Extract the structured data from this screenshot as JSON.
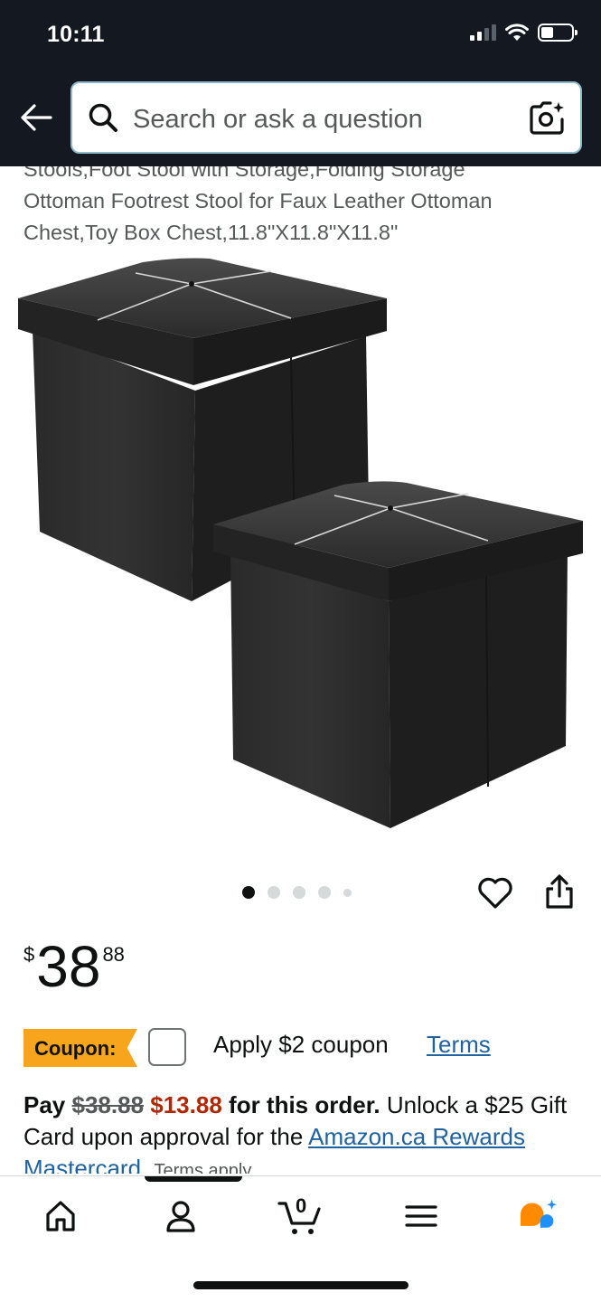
{
  "status_bar": {
    "time": "10:11"
  },
  "header": {
    "search_placeholder": "Search or ask a question"
  },
  "product": {
    "title_lines": [
      "Stools,Foot Stool with Storage,Folding Storage",
      "Ottoman Footrest Stool for Faux Leather Ottoman",
      "Chest,Toy Box Chest,11.8\"X11.8\"X11.8\""
    ],
    "image_count": 5,
    "active_image_index": 0
  },
  "price": {
    "symbol": "$",
    "whole": "38",
    "fraction": "88"
  },
  "coupon": {
    "badge": "Coupon:",
    "apply_text": "Apply $2 coupon",
    "terms_link": "Terms"
  },
  "offer": {
    "pay": "Pay",
    "original": "$38.88",
    "deal": "$13.88",
    "for_order": "for this order.",
    "unlock": "Unlock a $25 Gift Card upon approval for the",
    "link": "Amazon.ca Rewards Mastercard.",
    "terms": "Terms apply."
  },
  "colors": {
    "header_bg": "#141921",
    "coupon_badge": "#F7A51C",
    "deal_price": "#B12704",
    "link": "#2162A1",
    "rufus_orange": "#FF8A00",
    "rufus_blue": "#1E90FF"
  },
  "bottom_nav": {
    "cart_count": "0",
    "active_item": "account",
    "icons": [
      "home-icon",
      "account-icon",
      "cart-icon",
      "menu-icon",
      "rufus-icon"
    ]
  }
}
